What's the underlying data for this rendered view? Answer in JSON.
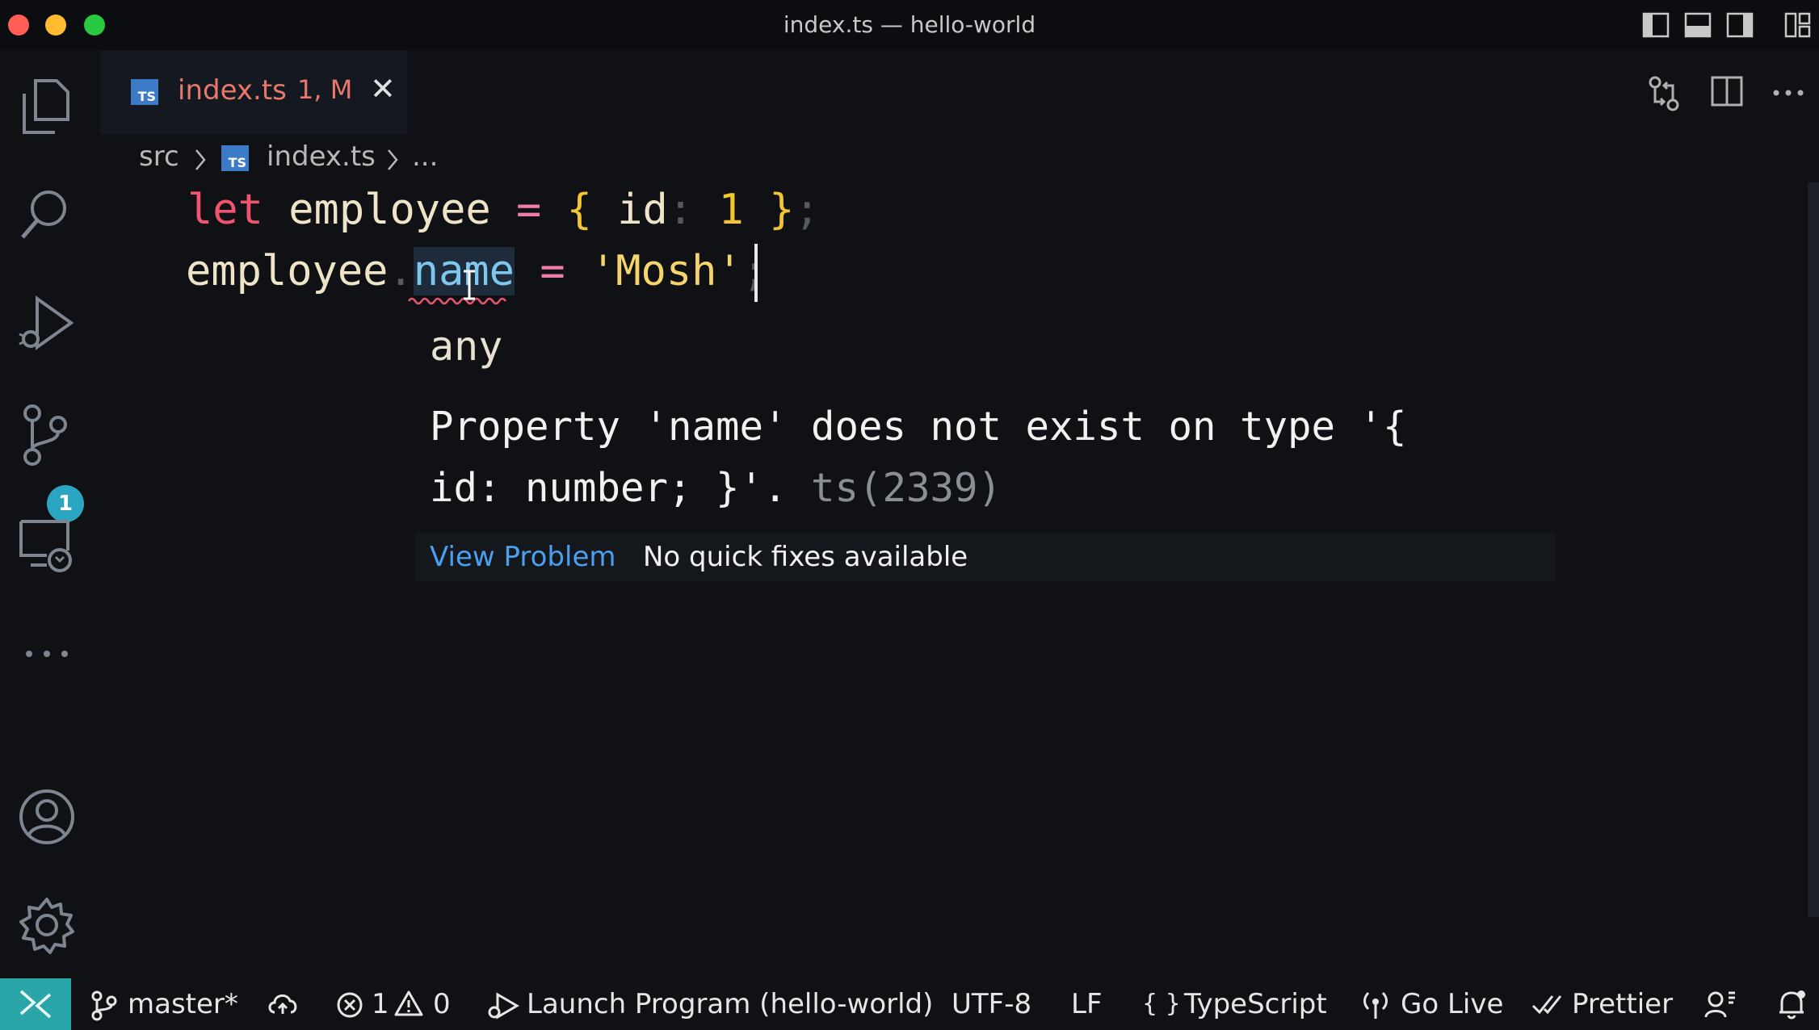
{
  "window": {
    "title": "index.ts — hello-world",
    "traffic_colors": {
      "close": "#ff5f57",
      "minimize": "#febc2e",
      "maximize": "#28c840"
    }
  },
  "activity_bar": {
    "items": [
      "explorer-icon",
      "search-icon",
      "run-debug-icon",
      "source-control-icon",
      "remote-explorer-icon",
      "more-icon"
    ],
    "source_control_badge": "1",
    "bottom_items": [
      "account-icon",
      "settings-gear-icon"
    ]
  },
  "tab": {
    "file_icon": "TS",
    "label": "index.ts",
    "status": "1, M",
    "close": "✕"
  },
  "breadcrumb": {
    "folder": "src",
    "file": "index.ts",
    "rest": "..."
  },
  "code": {
    "line1": {
      "kw": "let",
      "name": "employee",
      "eq": "=",
      "open": "{",
      "prop": "id",
      "colon": ":",
      "value": "1",
      "close": "}",
      "semi": ";"
    },
    "line2": {
      "obj": "employee",
      "dot": ".",
      "prop": "name",
      "eq": "=",
      "str": "'Mosh'",
      "semi": ";"
    }
  },
  "hover": {
    "type": "any",
    "message_line1": "Property 'name' does not exist on type '{",
    "message_line2": "id: number; }'.",
    "code": "ts(2339)",
    "view_problem": "View Problem",
    "no_fixes": "No quick fixes available"
  },
  "status_bar": {
    "branch": "master*",
    "errors": "1",
    "warnings": "0",
    "launch": "Launch Program (hello-world)",
    "encoding": "UTF-8",
    "eol": "LF",
    "language_braces": "{ }",
    "language": "TypeScript",
    "go_live": "Go Live",
    "prettier": "Prettier",
    "accent": "#2aa6a9"
  },
  "colors": {
    "keyword": "#f0546e",
    "identifier": "#efe3c8",
    "string": "#f5d56b",
    "error": "#e8786a",
    "link": "#4b9fef"
  }
}
